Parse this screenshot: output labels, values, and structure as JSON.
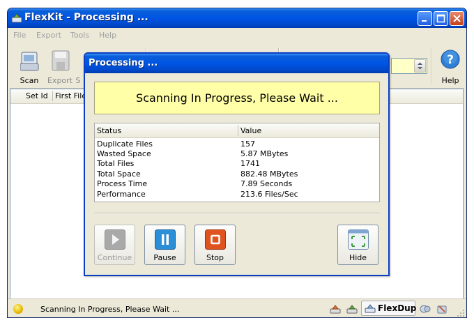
{
  "window": {
    "title": "FlexKit - Processing ..."
  },
  "menu": [
    "File",
    "Export",
    "Tools",
    "Help"
  ],
  "toolbar": {
    "scan_label": "Scan",
    "export_label": "Export",
    "partial_label": "S",
    "help_label": "Help"
  },
  "list": {
    "headers": [
      "Set Id",
      "First File"
    ]
  },
  "dialog": {
    "title": "Processing ...",
    "banner": "Scanning In Progress, Please Wait ...",
    "stats_header": {
      "status": "Status",
      "value": "Value"
    },
    "stats": [
      {
        "name": "Duplicate Files",
        "value": "157"
      },
      {
        "name": "Wasted Space",
        "value": "5.87 MBytes"
      },
      {
        "name": "Total Files",
        "value": "1741"
      },
      {
        "name": "Total Space",
        "value": "882.48 MBytes"
      },
      {
        "name": "Process Time",
        "value": "7.89 Seconds"
      },
      {
        "name": "Performance",
        "value": "213.6 Files/Sec"
      }
    ],
    "buttons": {
      "continue": "Continue",
      "pause": "Pause",
      "stop": "Stop",
      "hide": "Hide"
    }
  },
  "statusbar": {
    "text": "Scanning In Progress, Please Wait ...",
    "product": "FlexDup"
  },
  "colors": {
    "titlebar": "#0055e5",
    "banner_bg": "#ffffa8",
    "pause_icon": "#2b8fd8",
    "stop_icon": "#e0531f"
  }
}
